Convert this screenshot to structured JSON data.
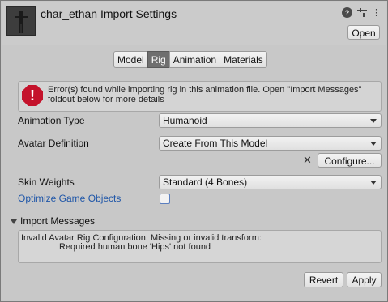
{
  "header": {
    "title": "char_ethan Import Settings",
    "open_label": "Open",
    "icons": [
      "help-icon",
      "settings-sliders-icon",
      "more-icon"
    ]
  },
  "tabs": [
    {
      "label": "Model",
      "active": false
    },
    {
      "label": "Rig",
      "active": true
    },
    {
      "label": "Animation",
      "active": false
    },
    {
      "label": "Materials",
      "active": false
    }
  ],
  "error": {
    "icon": "error-icon",
    "text_line1": "Error(s) found while importing rig in this animation file. Open \"Import Messages\"",
    "text_line2": "foldout below for more details"
  },
  "fields": {
    "animation_type": {
      "label": "Animation Type",
      "value": "Humanoid"
    },
    "avatar_definition": {
      "label": "Avatar Definition",
      "value": "Create From This Model"
    },
    "configure_label": "Configure...",
    "skin_weights": {
      "label": "Skin Weights",
      "value": "Standard (4 Bones)"
    },
    "optimize": {
      "label": "Optimize Game Objects",
      "checked": false
    }
  },
  "import_messages": {
    "label": "Import Messages",
    "line1": "Invalid Avatar Rig Configuration. Missing or invalid transform:",
    "line2": "Required human bone 'Hips' not found"
  },
  "footer": {
    "revert_label": "Revert",
    "apply_label": "Apply"
  },
  "colors": {
    "error_red": "#c4122b",
    "active_tab": "#6f6f6f",
    "link_blue": "#1f56a8"
  }
}
